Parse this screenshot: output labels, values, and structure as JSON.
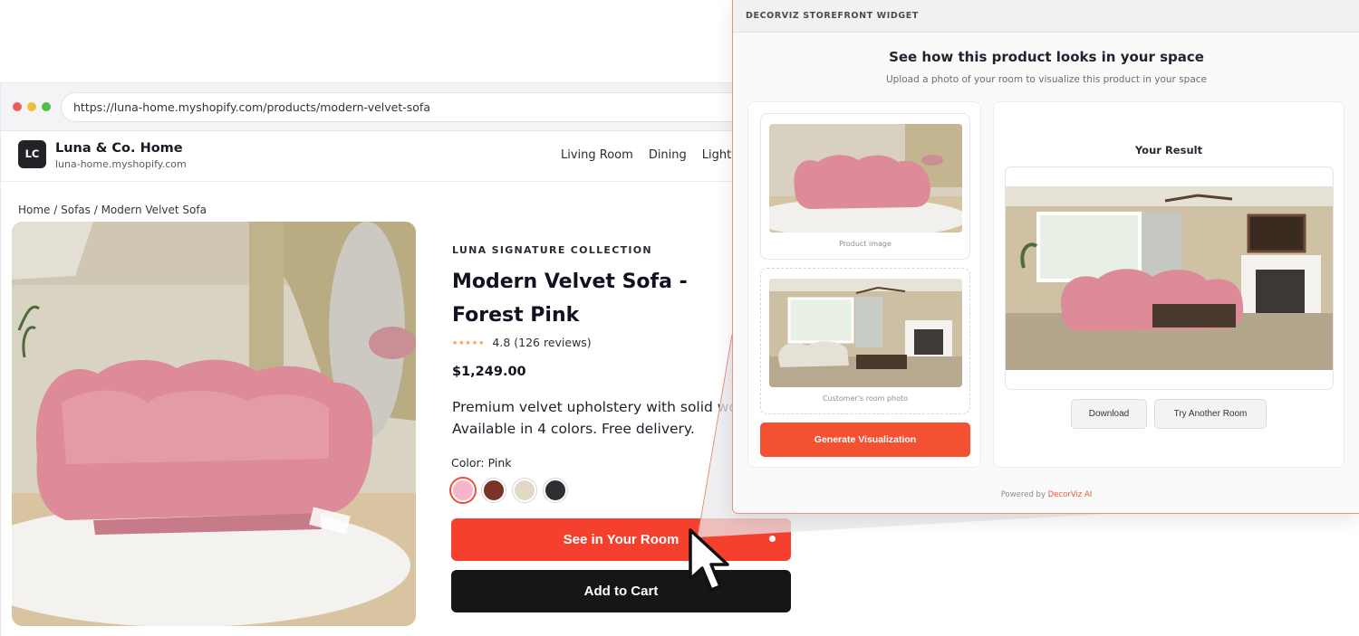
{
  "browser": {
    "url": "https://luna-home.myshopify.com/products/modern-velvet-sofa"
  },
  "store": {
    "logo_text": "LC",
    "name": "Luna & Co. Home",
    "domain": "luna-home.myshopify.com",
    "nav": [
      "Living Room",
      "Dining",
      "Lightin"
    ]
  },
  "breadcrumb": "Home / Sofas / Modern Velvet Sofa",
  "product": {
    "collection": "LUNA SIGNATURE COLLECTION",
    "title": "Modern Velvet Sofa - Forest Pink",
    "stars": "★★★★★",
    "rating_text": "4.8 (126 reviews)",
    "price": "$1,249.00",
    "description_line1": "Premium velvet upholstery with solid woo",
    "description_line2": "Available in 4 colors. Free delivery.",
    "color_label": "Color: Pink",
    "swatches": [
      "#f6b5c9",
      "#7a3326",
      "#e2d8c6",
      "#2d2f33"
    ],
    "see_in_room_label": "See in Your Room",
    "add_to_cart_label": "Add to Cart"
  },
  "widget": {
    "header_label": "DECORVIZ STOREFRONT WIDGET",
    "title": "See how this product looks in your space",
    "subtitle": "Upload a photo of your room to visualize this product in your space",
    "product_caption": "Product image",
    "room_caption": "Customer's room photo",
    "generate_label": "Generate Visualization",
    "result_label": "Your Result",
    "download_label": "Download",
    "try_another_label": "Try Another Room",
    "powered_prefix": "Powered by",
    "powered_brand": "DecorViz AI"
  },
  "colors": {
    "accent": "#f4402c",
    "dark_button": "#161618",
    "sofa_pink": "#dd8a99"
  }
}
